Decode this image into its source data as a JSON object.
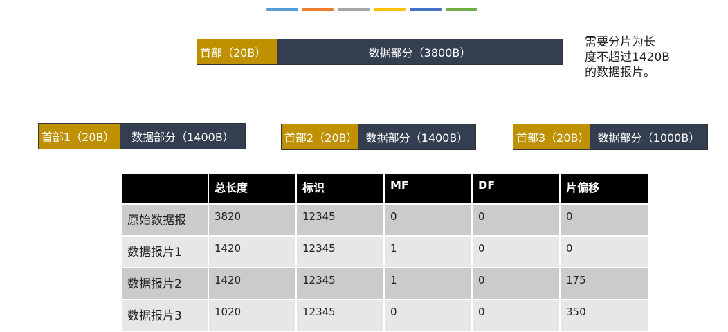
{
  "stripes": [
    "#5b9bd5",
    "#ed7d31",
    "#a5a5a5",
    "#ffc000",
    "#4472c4",
    "#70ad47"
  ],
  "colors": {
    "header": "#bf9000",
    "data": "#333f50"
  },
  "original": {
    "header": "首部（20B）",
    "data": "数据部分（3800B）"
  },
  "note": {
    "line1": "需要分片为长",
    "line2": "度不超过1420B",
    "line3": "的数据报片。"
  },
  "fragments": [
    {
      "header": "首部1（20B）",
      "data": "数据部分（1400B）"
    },
    {
      "header": "首部2（20B）",
      "data": "数据部分（1400B）"
    },
    {
      "header": "首部3（20B）",
      "data": "数据部分（1000B）"
    }
  ],
  "table": {
    "headers": [
      "",
      "总长度",
      "标识",
      "MF",
      "DF",
      "片偏移"
    ],
    "rows": [
      [
        "原始数据报",
        "3820",
        "12345",
        "0",
        "0",
        "0"
      ],
      [
        "数据报片1",
        "1420",
        "12345",
        "1",
        "0",
        "0"
      ],
      [
        "数据报片2",
        "1420",
        "12345",
        "1",
        "0",
        "175"
      ],
      [
        "数据报片3",
        "1020",
        "12345",
        "0",
        "0",
        "350"
      ]
    ]
  }
}
